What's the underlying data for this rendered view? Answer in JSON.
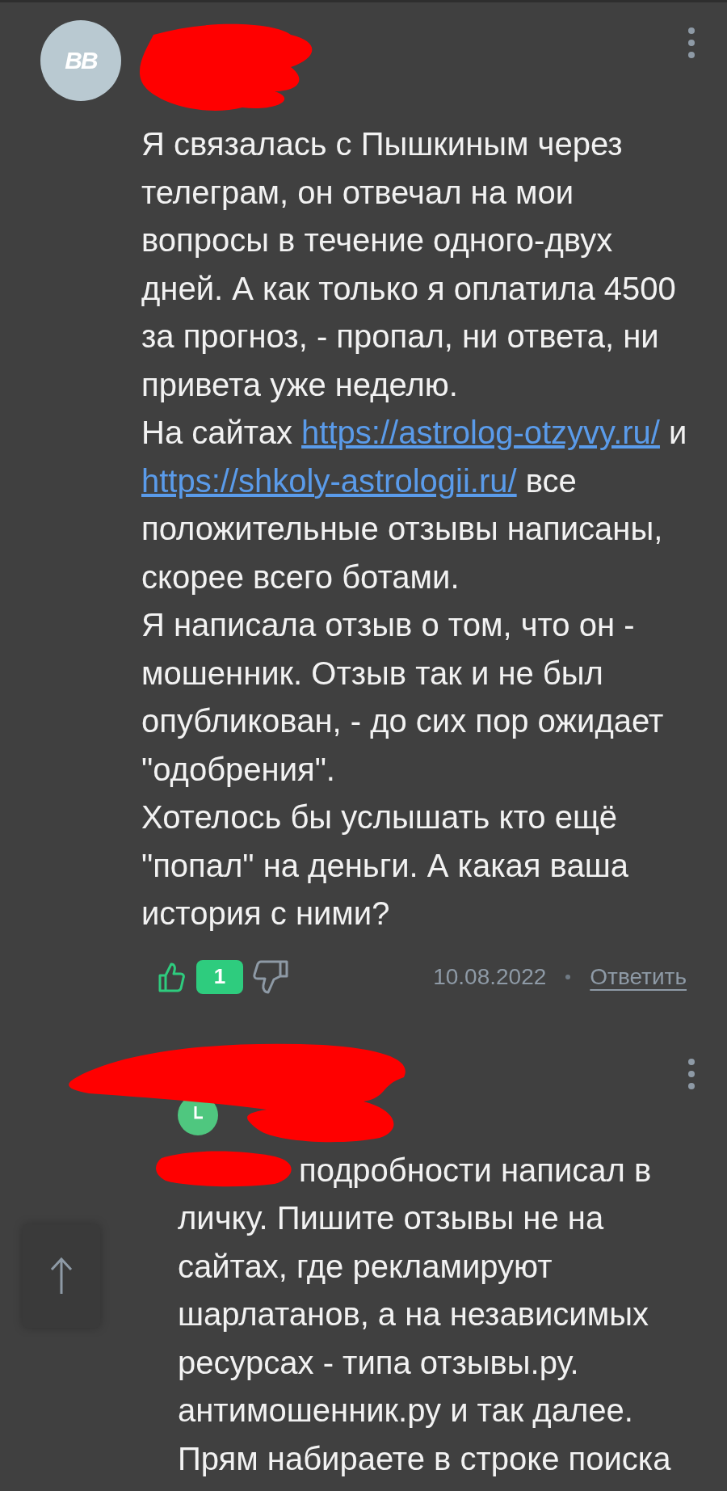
{
  "comments": [
    {
      "avatar_initials": "ВВ",
      "paragraphs": [
        {
          "parts": [
            {
              "kind": "text",
              "text": "Я связалась с Пышкиным через телеграм, он отвечал на мои вопросы в течение одного-двух дней. А как только я оплатила 4500 за прогноз, - пропал, ни ответа, ни привета уже неделю."
            }
          ]
        },
        {
          "parts": [
            {
              "kind": "text",
              "text": "На сайтах "
            },
            {
              "kind": "link",
              "text": "https://astrolog-otzyvy.ru/"
            },
            {
              "kind": "text",
              "text": " и "
            },
            {
              "kind": "link",
              "text": "https://shkoly-astrologii.ru/"
            },
            {
              "kind": "text",
              "text": " все положительные отзывы написаны, скорее всего ботами."
            }
          ]
        },
        {
          "parts": [
            {
              "kind": "text",
              "text": "Я написала отзыв о том, что он - мошенник. Отзыв так и не был опубликован, - до сих пор ожидает \"одобрения\"."
            }
          ]
        },
        {
          "parts": [
            {
              "kind": "text",
              "text": "Хотелось бы услышать кто ещё \"попал\" на деньги. А какая ваша история с ними?"
            }
          ]
        }
      ],
      "likes": "1",
      "date": "10.08.2022",
      "reply": "Ответить"
    },
    {
      "paragraphs": [
        {
          "parts": [
            {
              "kind": "text",
              "text": "подробности написал в"
            }
          ]
        },
        {
          "parts": [
            {
              "kind": "text",
              "text": "личку. Пишите отзывы не на сайтах, где рекламируют шарлатанов, а на независимых ресурсах - типа отзывы.ру. антимошенник.ру и так далее. Прям набираете в строке поиска"
            }
          ]
        }
      ]
    }
  ]
}
